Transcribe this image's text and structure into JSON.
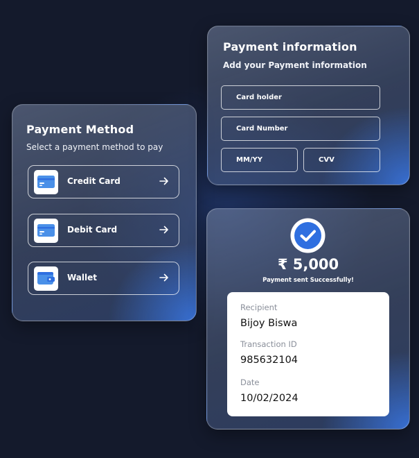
{
  "payment_method": {
    "title": "Payment Method",
    "subtitle": "Select a payment method to pay",
    "methods": [
      {
        "label": "Credit Card",
        "icon": "credit-card-icon"
      },
      {
        "label": "Debit Card",
        "icon": "debit-card-icon"
      },
      {
        "label": "Wallet",
        "icon": "wallet-icon"
      }
    ]
  },
  "payment_info": {
    "title": "Payment information",
    "subtitle": "Add your Payment information",
    "fields": {
      "card_holder": {
        "placeholder": "Card holder",
        "value": ""
      },
      "card_number": {
        "placeholder": "Card Number",
        "value": ""
      },
      "expiry": {
        "placeholder": "MM/YY",
        "value": ""
      },
      "cvv": {
        "placeholder": "CVV",
        "value": ""
      }
    }
  },
  "payment_success": {
    "icon": "check-circle-icon",
    "amount": "₹ 5,000",
    "message": "Payment sent Successfully!",
    "details": {
      "recipient_label": "Recipient",
      "recipient_value": "Bijoy Biswa",
      "transaction_label": "Transaction ID",
      "transaction_value": "985632104",
      "date_label": "Date",
      "date_value": "10/02/2024"
    }
  },
  "colors": {
    "background": "#141a2c",
    "accent_blue": "#2f6fe0",
    "icon_blue": "#4a90e8",
    "text_white": "#ffffff",
    "label_gray": "#8a8f9a"
  }
}
